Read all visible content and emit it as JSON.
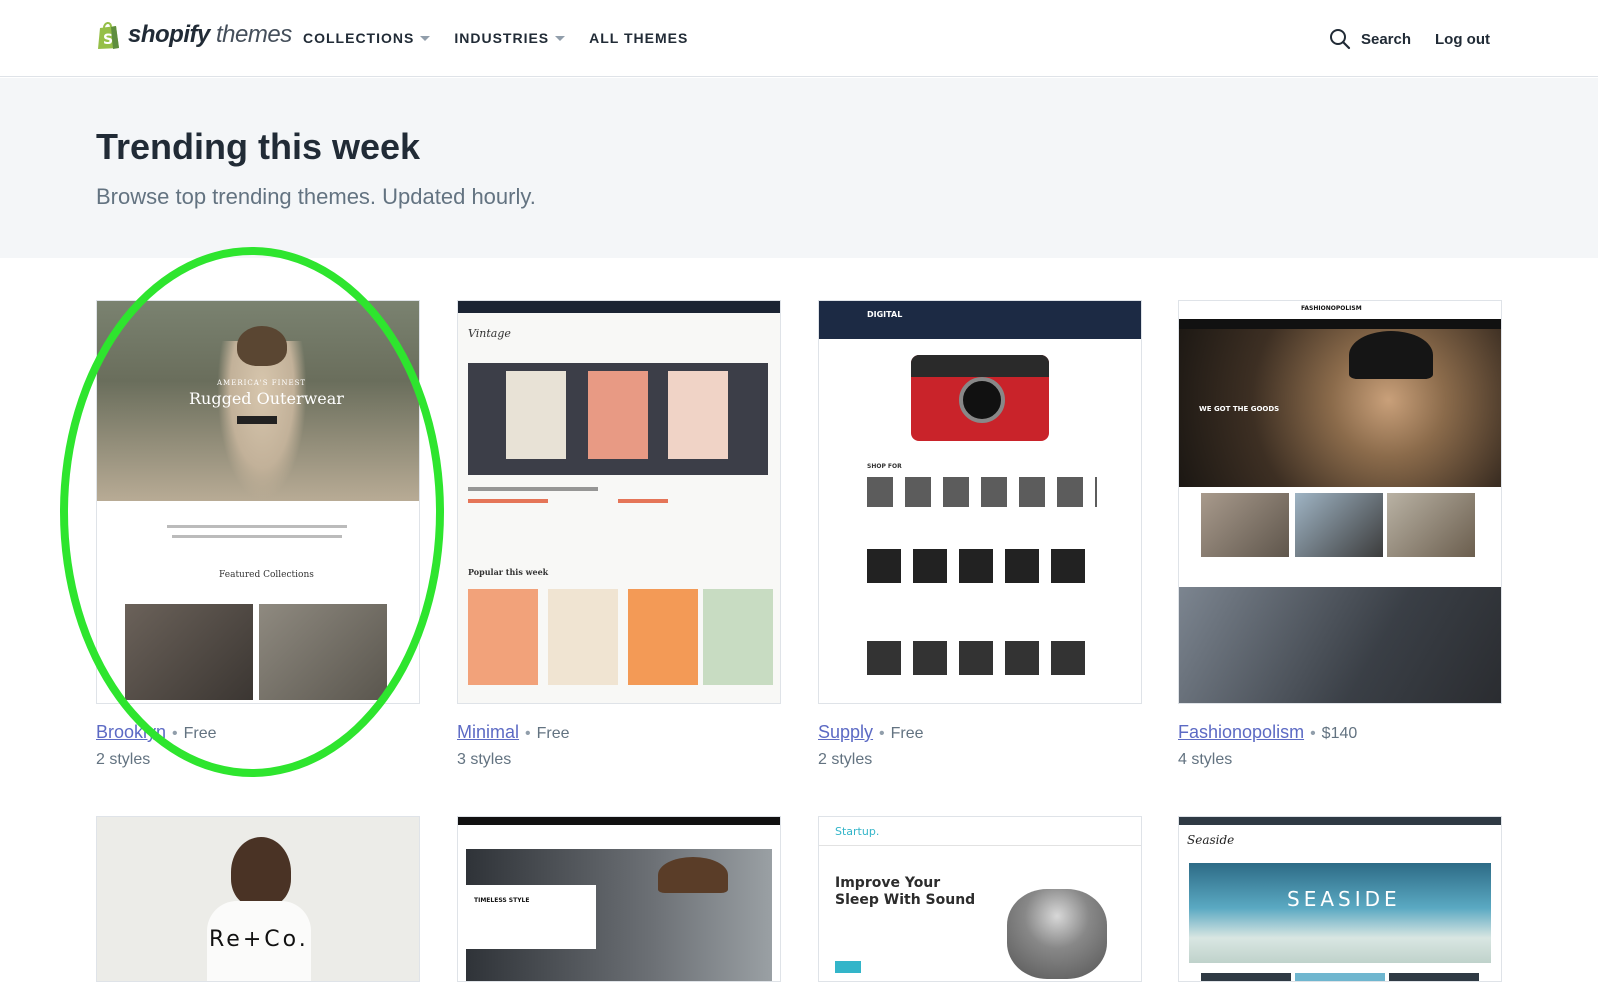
{
  "header": {
    "logo_brand": "shopify",
    "logo_suffix": "themes",
    "nav": [
      {
        "label": "COLLECTIONS"
      },
      {
        "label": "INDUSTRIES"
      },
      {
        "label": "ALL THEMES"
      }
    ],
    "search_label": "Search",
    "logout_label": "Log out"
  },
  "hero": {
    "title": "Trending this week",
    "subtitle": "Browse top trending themes. Updated hourly."
  },
  "themes": [
    {
      "name": "Brooklyn",
      "price": "Free",
      "styles": "2 styles",
      "preview_text": "Rugged Outerwear",
      "preview_kicker": "AMERICA'S FINEST",
      "preview_sub": "Featured Collections"
    },
    {
      "name": "Minimal",
      "price": "Free",
      "styles": "3 styles",
      "preview_text": "Vintage",
      "preview_sub": "Popular this week"
    },
    {
      "name": "Supply",
      "price": "Free",
      "styles": "2 styles",
      "preview_text": "DIGITAL",
      "preview_sub": "SHOP FOR"
    },
    {
      "name": "Fashionopolism",
      "price": "$140",
      "styles": "4 styles",
      "preview_text": "FASHIONOPOLISM",
      "preview_sub": "WE GOT THE GOODS"
    }
  ],
  "themes_row2": [
    {
      "preview_text": "Re+Co."
    },
    {
      "preview_text": "TIMELESS STYLE"
    },
    {
      "preview_text": "Improve Your Sleep With Sound",
      "preview_brand": "Startup."
    },
    {
      "preview_text": "SEASIDE",
      "preview_brand": "Seaside"
    }
  ],
  "colors": {
    "link": "#5c6ac4",
    "annotation": "#2ee52e",
    "hero_bg": "#f4f6f8"
  },
  "icons": [
    "shopify-bag-icon",
    "caret-down-icon",
    "search-icon"
  ]
}
